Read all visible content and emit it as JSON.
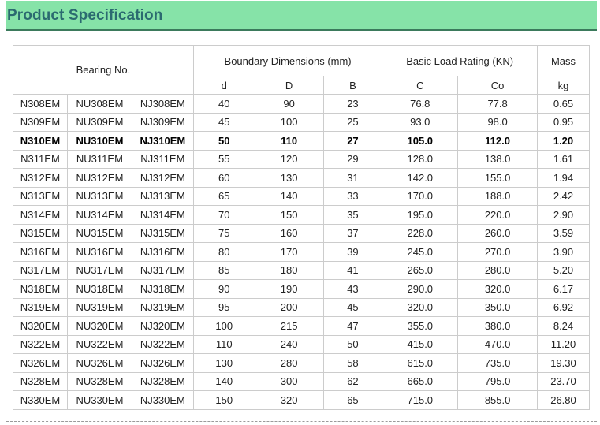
{
  "header": {
    "title": "Product Specification"
  },
  "table": {
    "head1": {
      "bearing_no": "Bearing No.",
      "boundary": "Boundary Dimensions (mm)",
      "load": "Basic Load Rating (KN)",
      "mass": "Mass"
    },
    "head2": [
      "d",
      "D",
      "B",
      "C",
      "Co",
      "kg"
    ],
    "bold_row": 2,
    "rows": [
      [
        "N308EM",
        "NU308EM",
        "NJ308EM",
        "40",
        "90",
        "23",
        "76.8",
        "77.8",
        "0.65"
      ],
      [
        "N309EM",
        "NU309EM",
        "NJ309EM",
        "45",
        "100",
        "25",
        "93.0",
        "98.0",
        "0.95"
      ],
      [
        "N310EM",
        "NU310EM",
        "NJ310EM",
        "50",
        "110",
        "27",
        "105.0",
        "112.0",
        "1.20"
      ],
      [
        "N311EM",
        "NU311EM",
        "NJ311EM",
        "55",
        "120",
        "29",
        "128.0",
        "138.0",
        "1.61"
      ],
      [
        "N312EM",
        "NU312EM",
        "NJ312EM",
        "60",
        "130",
        "31",
        "142.0",
        "155.0",
        "1.94"
      ],
      [
        "N313EM",
        "NU313EM",
        "NJ313EM",
        "65",
        "140",
        "33",
        "170.0",
        "188.0",
        "2.42"
      ],
      [
        "N314EM",
        "NU314EM",
        "NJ314EM",
        "70",
        "150",
        "35",
        "195.0",
        "220.0",
        "2.90"
      ],
      [
        "N315EM",
        "NU315EM",
        "NJ315EM",
        "75",
        "160",
        "37",
        "228.0",
        "260.0",
        "3.59"
      ],
      [
        "N316EM",
        "NU316EM",
        "NJ316EM",
        "80",
        "170",
        "39",
        "245.0",
        "270.0",
        "3.90"
      ],
      [
        "N317EM",
        "NU317EM",
        "NJ317EM",
        "85",
        "180",
        "41",
        "265.0",
        "280.0",
        "5.20"
      ],
      [
        "N318EM",
        "NU318EM",
        "NJ318EM",
        "90",
        "190",
        "43",
        "290.0",
        "320.0",
        "6.17"
      ],
      [
        "N319EM",
        "NU319EM",
        "NJ319EM",
        "95",
        "200",
        "45",
        "320.0",
        "350.0",
        "6.92"
      ],
      [
        "N320EM",
        "NU320EM",
        "NJ320EM",
        "100",
        "215",
        "47",
        "355.0",
        "380.0",
        "8.24"
      ],
      [
        "N322EM",
        "NU322EM",
        "NJ322EM",
        "110",
        "240",
        "50",
        "415.0",
        "470.0",
        "11.20"
      ],
      [
        "N326EM",
        "NU326EM",
        "NJ326EM",
        "130",
        "280",
        "58",
        "615.0",
        "735.0",
        "19.30"
      ],
      [
        "N328EM",
        "NU328EM",
        "NJ328EM",
        "140",
        "300",
        "62",
        "665.0",
        "795.0",
        "23.70"
      ],
      [
        "N330EM",
        "NU330EM",
        "NJ330EM",
        "150",
        "320",
        "65",
        "715.0",
        "855.0",
        "26.80"
      ]
    ]
  }
}
